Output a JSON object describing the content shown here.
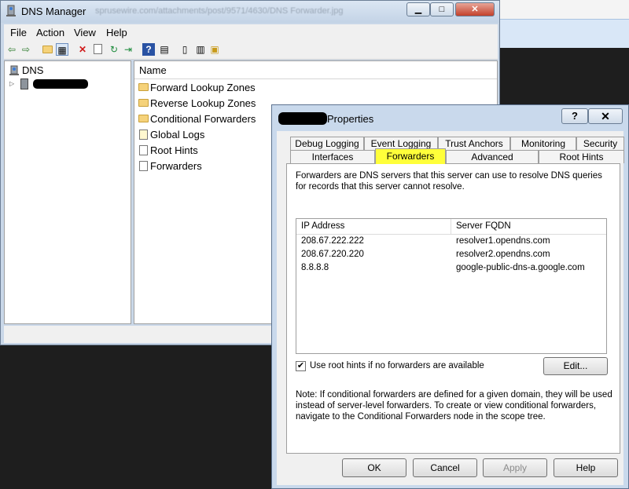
{
  "manager": {
    "title": "DNS Manager",
    "url_fragment": "sprusewire.com/attachments/post/9571/4630/DNS Forwarder.jpg",
    "menu": [
      "File",
      "Action",
      "View",
      "Help"
    ],
    "tree": {
      "root": "DNS"
    },
    "list": {
      "header": "Name",
      "items": [
        "Forward Lookup Zones",
        "Reverse Lookup Zones",
        "Conditional Forwarders",
        "Global Logs",
        "Root Hints",
        "Forwarders"
      ]
    }
  },
  "dialog": {
    "title": "Properties",
    "help_glyph": "?",
    "close_glyph": "✕",
    "tabs_row1": [
      "Debug Logging",
      "Event Logging",
      "Trust Anchors",
      "Monitoring",
      "Security"
    ],
    "tabs_row2": [
      "Interfaces",
      "Forwarders",
      "Advanced",
      "Root Hints"
    ],
    "active_tab": "Forwarders",
    "description": "Forwarders are DNS servers that this server can use to resolve DNS queries for records that this server cannot resolve.",
    "table": {
      "columns": [
        "IP Address",
        "Server FQDN"
      ],
      "rows": [
        [
          "208.67.222.222",
          "resolver1.opendns.com"
        ],
        [
          "208.67.220.220",
          "resolver2.opendns.com"
        ],
        [
          "8.8.8.8",
          "google-public-dns-a.google.com"
        ]
      ]
    },
    "use_root_hints_label": "Use root hints if no forwarders are available",
    "use_root_hints_checked": true,
    "edit_label": "Edit...",
    "note": "Note: If conditional forwarders are defined for a given domain, they will be used instead of server-level forwarders.  To create or view conditional forwarders, navigate to the Conditional Forwarders node in the scope tree.",
    "buttons": {
      "ok": "OK",
      "cancel": "Cancel",
      "apply": "Apply",
      "help": "Help"
    }
  },
  "colors": {
    "highlight": "#ffff3a",
    "title_bar": "#c9d9ec"
  }
}
